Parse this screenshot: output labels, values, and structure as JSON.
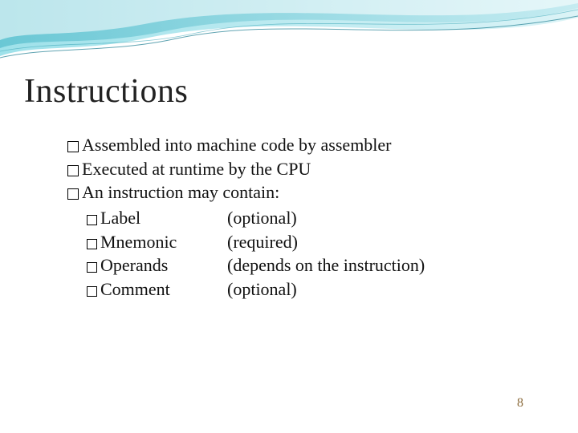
{
  "title": "Instructions",
  "bullets": [
    {
      "text": "Assembled into machine code by assembler"
    },
    {
      "text": "Executed at runtime by the CPU"
    },
    {
      "text": "An instruction may contain:"
    }
  ],
  "parts": [
    {
      "name": "Label",
      "note": "(optional)"
    },
    {
      "name": "Mnemonic",
      "note": "(required)"
    },
    {
      "name": "Operands",
      "note": "(depends on the instruction)"
    },
    {
      "name": "Comment",
      "note": "(optional)"
    }
  ],
  "page_number": "8"
}
